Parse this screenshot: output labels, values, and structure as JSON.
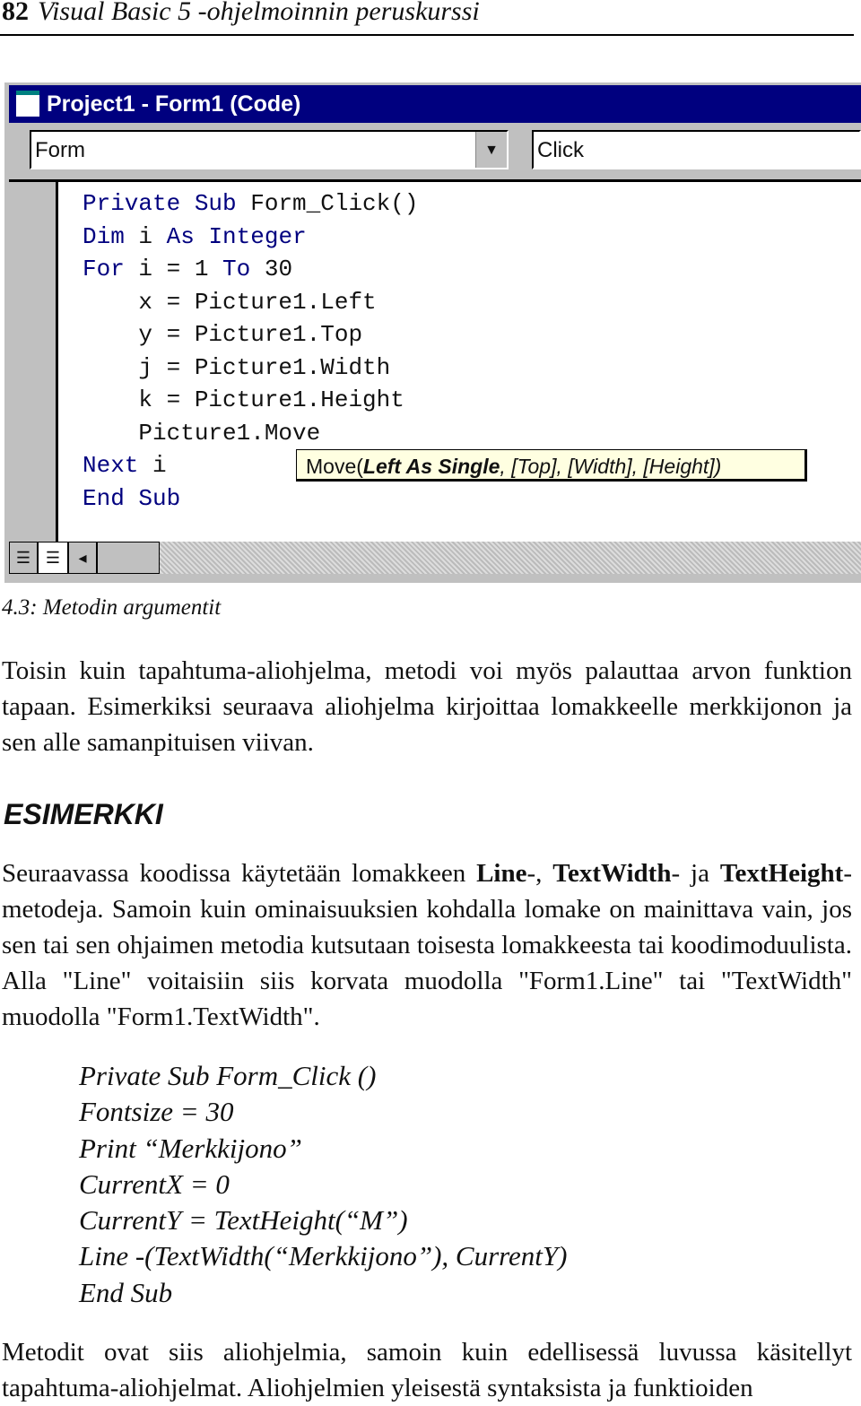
{
  "header": {
    "page_number": "82",
    "book_title": "Visual Basic 5 -ohjelmoinnin peruskurssi"
  },
  "window": {
    "title": "Project1 - Form1 (Code)",
    "object_combo": "Form",
    "proc_combo": "Click",
    "code_lines": [
      [
        [
          "kw",
          "Private Sub "
        ],
        [
          "t",
          "Form_Click()"
        ]
      ],
      [
        [
          "kw",
          "Dim "
        ],
        [
          "t",
          "i "
        ],
        [
          "kw",
          "As Integer"
        ]
      ],
      [
        [
          "kw",
          "For "
        ],
        [
          "t",
          "i = 1 "
        ],
        [
          "kw",
          "To "
        ],
        [
          "t",
          "30"
        ]
      ],
      [
        [
          "t",
          "    x = Picture1.Left"
        ]
      ],
      [
        [
          "t",
          "    y = Picture1.Top"
        ]
      ],
      [
        [
          "t",
          "    j = Picture1.Width"
        ]
      ],
      [
        [
          "t",
          "    k = Picture1.Height"
        ]
      ],
      [
        [
          "t",
          "    Picture1.Move"
        ]
      ],
      [
        [
          "kw",
          "Next "
        ],
        [
          "t",
          "i"
        ]
      ],
      [
        [
          "kw",
          "End Sub"
        ]
      ]
    ],
    "tooltip": {
      "prefix": "Move(",
      "bold": "Left As Single",
      "rest": ", [Top], [Width], [Height])"
    }
  },
  "caption": "4.3: Metodin argumentit",
  "para1": "Toisin kuin tapahtuma-aliohjelma, metodi voi myös palauttaa arvon funktion tapaan. Esimerkiksi seuraava aliohjelma kirjoittaa lomakkeelle merkkijonon ja sen alle samanpituisen viivan.",
  "heading": "ESIMERKKI",
  "para2": [
    [
      "t",
      "Seuraavassa koodissa käytetään lomakkeen "
    ],
    [
      "b",
      "Line"
    ],
    [
      "t",
      "-, "
    ],
    [
      "b",
      "TextWidth"
    ],
    [
      "t",
      "- ja "
    ],
    [
      "b",
      "TextHeight"
    ],
    [
      "t",
      "-metodeja. Samoin kuin ominaisuuksien kohdalla lomake on mainittava vain, jos sen tai sen ohjaimen metodia kutsutaan toisesta lomakkeesta tai koodimoduulista. Alla \"Line\" voitaisiin siis korvata muodolla \"Form1.Line\"  tai \"TextWidth\" muodolla \"Form1.TextWidth\"."
    ]
  ],
  "example_code": [
    "Private Sub Form_Click ()",
    "Fontsize = 30",
    "Print “Merkkijono”",
    "CurrentX = 0",
    "CurrentY = TextHeight(“M”)",
    "Line -(TextWidth(“Merkkijono”), CurrentY)",
    "End Sub"
  ],
  "para3": "Metodit ovat siis aliohjelmia, samoin kuin edellisessä luvussa käsitellyt tapahtuma-aliohjelmat.  Aliohjelmien yleisestä syntaksista ja funktioiden"
}
